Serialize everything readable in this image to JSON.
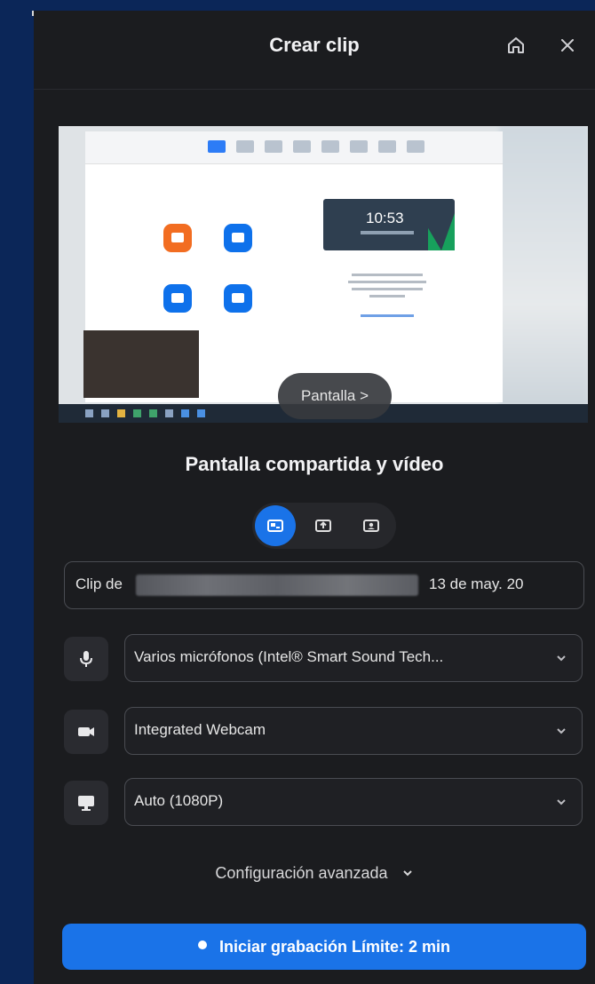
{
  "header": {
    "title": "Crear clip",
    "home_icon": "home-icon",
    "close_icon": "close-icon"
  },
  "preview": {
    "pill_label": "Pantalla >",
    "clock_time": "10:53"
  },
  "mode": {
    "label": "Pantalla compartida y vídeo",
    "options": [
      "screen-and-video",
      "screen-only",
      "video-only"
    ],
    "active_index": 0
  },
  "clip_name": {
    "prefix": "Clip de",
    "suffix": "13 de may. 20"
  },
  "devices": {
    "microphone": {
      "icon": "microphone-icon",
      "value": "Varios micrófonos (Intel® Smart Sound Tech..."
    },
    "camera": {
      "icon": "camera-icon",
      "value": "Integrated Webcam"
    },
    "resolution": {
      "icon": "monitor-icon",
      "value": "Auto (1080P)"
    }
  },
  "advanced": {
    "label": "Configuración avanzada"
  },
  "record_button": {
    "label": "Iniciar grabación Límite: 2 min"
  },
  "colors": {
    "accent": "#1a73e8",
    "panel_bg": "#1b1c1f",
    "outer_bg": "#0b2658"
  }
}
